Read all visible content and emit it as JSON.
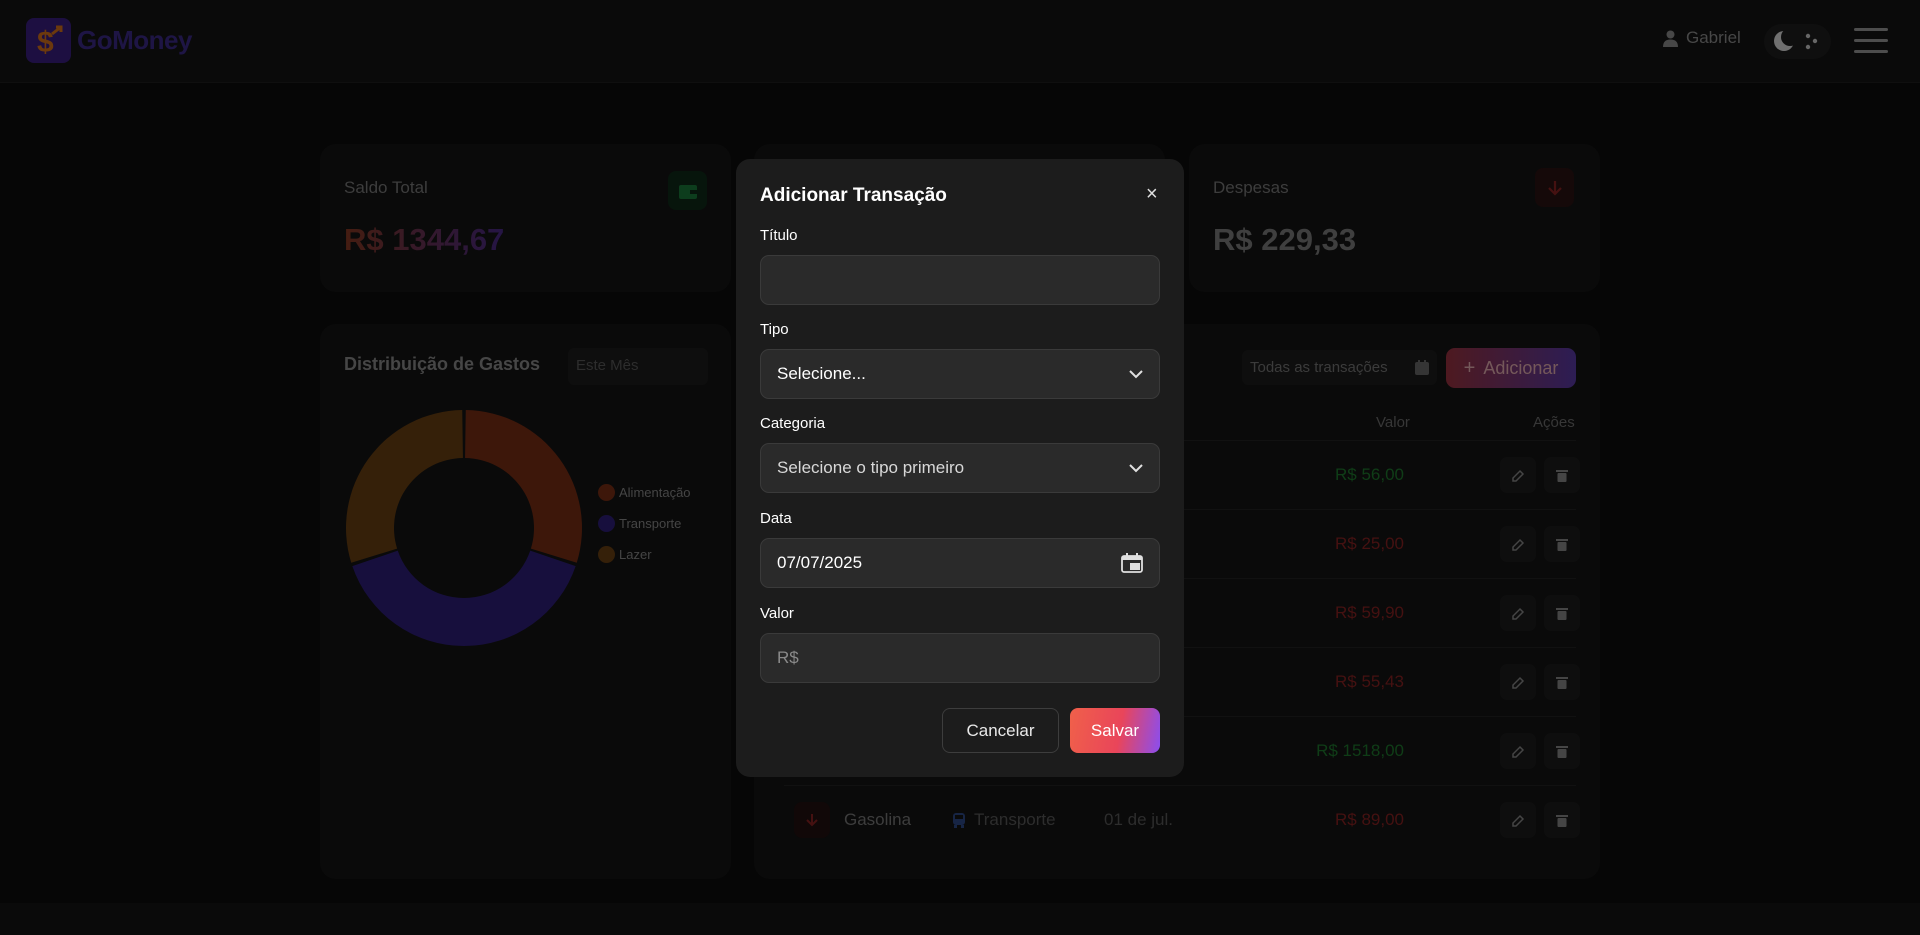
{
  "header": {
    "app_name": "GoMoney",
    "user_name": "Gabriel"
  },
  "cards": {
    "balance_label": "Saldo Total",
    "balance_value": "R$ 1344,67",
    "expenses_label": "Despesas",
    "expenses_value": "R$ 229,33"
  },
  "chart": {
    "title": "Distribuição de Gastos",
    "period_placeholder": "Este Mês"
  },
  "chart_data": {
    "type": "pie",
    "categories": [
      "Alimentação",
      "Transporte",
      "Lazer"
    ],
    "values": [
      30,
      40,
      30
    ],
    "colors": [
      "#7a2e14",
      "#2f1f7a",
      "#6b4012"
    ]
  },
  "transactions": {
    "filter_label": "Todas as transações",
    "add_label": "Adicionar",
    "col_value": "Valor",
    "col_actions": "Ações",
    "rows": [
      {
        "value": "R$ 56,00",
        "color": "#1f7a2e"
      },
      {
        "value": "R$ 25,00",
        "color": "#8a2222"
      },
      {
        "value": "R$ 59,90",
        "color": "#8a2222"
      },
      {
        "value": "R$ 55,43",
        "color": "#8a2222"
      },
      {
        "value": "R$ 1518,00",
        "color": "#1f7a2e"
      },
      {
        "value": "R$ 89,00",
        "color": "#8a2222",
        "title": "Gasolina",
        "category": "Transporte",
        "date": "01 de jul."
      }
    ]
  },
  "modal": {
    "title": "Adicionar Transação",
    "close": "×",
    "title_label": "Título",
    "title_value": "",
    "type_label": "Tipo",
    "type_value": "Selecione...",
    "category_label": "Categoria",
    "category_value": "Selecione o tipo primeiro",
    "date_label": "Data",
    "date_value": "07/07/2025",
    "amount_label": "Valor",
    "amount_placeholder": "R$",
    "cancel": "Cancelar",
    "save": "Salvar"
  }
}
